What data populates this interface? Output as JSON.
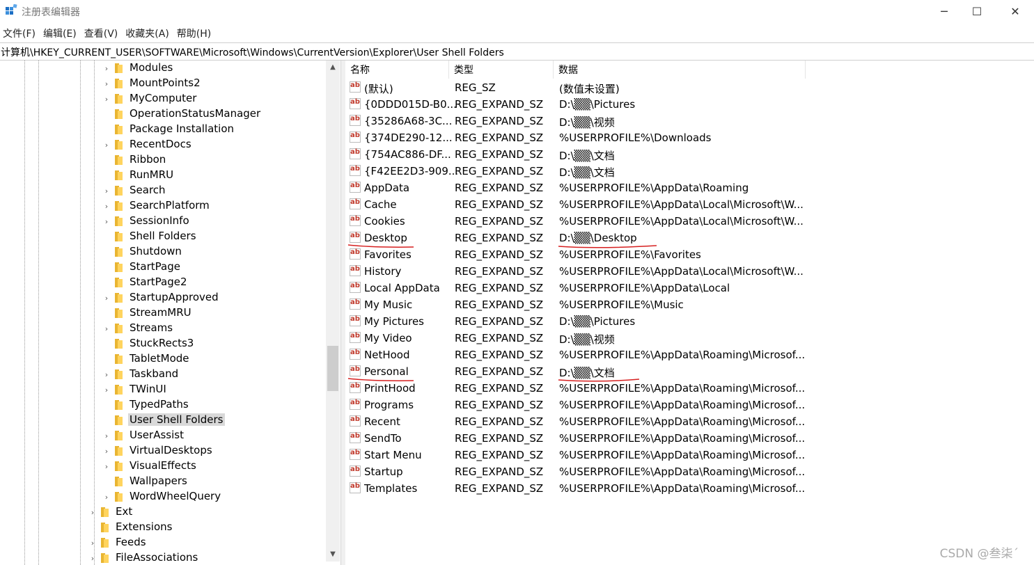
{
  "window": {
    "title": "注册表编辑器",
    "minimize": "─",
    "maximize": "☐",
    "close": "✕"
  },
  "menu": [
    "文件(F)",
    "编辑(E)",
    "查看(V)",
    "收藏夹(A)",
    "帮助(H)"
  ],
  "address": "计算机\\HKEY_CURRENT_USER\\SOFTWARE\\Microsoft\\Windows\\CurrentVersion\\Explorer\\User Shell Folders",
  "tree": {
    "items": [
      {
        "label": "Modules",
        "expander": true,
        "level": 2
      },
      {
        "label": "MountPoints2",
        "expander": true,
        "level": 2
      },
      {
        "label": "MyComputer",
        "expander": true,
        "level": 2
      },
      {
        "label": "OperationStatusManager",
        "expander": false,
        "level": 2
      },
      {
        "label": "Package Installation",
        "expander": false,
        "level": 2
      },
      {
        "label": "RecentDocs",
        "expander": true,
        "level": 2
      },
      {
        "label": "Ribbon",
        "expander": false,
        "level": 2
      },
      {
        "label": "RunMRU",
        "expander": false,
        "level": 2
      },
      {
        "label": "Search",
        "expander": true,
        "level": 2
      },
      {
        "label": "SearchPlatform",
        "expander": true,
        "level": 2
      },
      {
        "label": "SessionInfo",
        "expander": true,
        "level": 2
      },
      {
        "label": "Shell Folders",
        "expander": false,
        "level": 2
      },
      {
        "label": "Shutdown",
        "expander": false,
        "level": 2
      },
      {
        "label": "StartPage",
        "expander": false,
        "level": 2
      },
      {
        "label": "StartPage2",
        "expander": false,
        "level": 2
      },
      {
        "label": "StartupApproved",
        "expander": true,
        "level": 2
      },
      {
        "label": "StreamMRU",
        "expander": false,
        "level": 2
      },
      {
        "label": "Streams",
        "expander": true,
        "level": 2
      },
      {
        "label": "StuckRects3",
        "expander": false,
        "level": 2
      },
      {
        "label": "TabletMode",
        "expander": false,
        "level": 2
      },
      {
        "label": "Taskband",
        "expander": true,
        "level": 2
      },
      {
        "label": "TWinUI",
        "expander": true,
        "level": 2
      },
      {
        "label": "TypedPaths",
        "expander": false,
        "level": 2
      },
      {
        "label": "User Shell Folders",
        "expander": false,
        "level": 2,
        "selected": true
      },
      {
        "label": "UserAssist",
        "expander": true,
        "level": 2
      },
      {
        "label": "VirtualDesktops",
        "expander": true,
        "level": 2
      },
      {
        "label": "VisualEffects",
        "expander": true,
        "level": 2
      },
      {
        "label": "Wallpapers",
        "expander": false,
        "level": 2
      },
      {
        "label": "WordWheelQuery",
        "expander": true,
        "level": 2
      },
      {
        "label": "Ext",
        "expander": true,
        "level": 1
      },
      {
        "label": "Extensions",
        "expander": false,
        "level": 1
      },
      {
        "label": "Feeds",
        "expander": true,
        "level": 1
      },
      {
        "label": "FileAssociations",
        "expander": true,
        "level": 1
      }
    ],
    "expander_glyph": "›",
    "scroll_up": "▲",
    "scroll_down": "▼"
  },
  "list": {
    "columns": [
      "名称",
      "类型",
      "数据"
    ],
    "icon_text": "ab",
    "rows": [
      {
        "name": "(默认)",
        "type": "REG_SZ",
        "data": "(数值未设置)"
      },
      {
        "name": "{0DDD015D-B0...",
        "type": "REG_EXPAND_SZ",
        "data": "D:\\▒▒\\Pictures"
      },
      {
        "name": "{35286A68-3C...",
        "type": "REG_EXPAND_SZ",
        "data": "D:\\▒▒\\视频"
      },
      {
        "name": "{374DE290-12...",
        "type": "REG_EXPAND_SZ",
        "data": "%USERPROFILE%\\Downloads"
      },
      {
        "name": "{754AC886-DF...",
        "type": "REG_EXPAND_SZ",
        "data": "D:\\▒▒\\文档"
      },
      {
        "name": "{F42EE2D3-909...",
        "type": "REG_EXPAND_SZ",
        "data": "D:\\▒▒\\文档"
      },
      {
        "name": "AppData",
        "type": "REG_EXPAND_SZ",
        "data": "%USERPROFILE%\\AppData\\Roaming"
      },
      {
        "name": "Cache",
        "type": "REG_EXPAND_SZ",
        "data": "%USERPROFILE%\\AppData\\Local\\Microsoft\\W..."
      },
      {
        "name": "Cookies",
        "type": "REG_EXPAND_SZ",
        "data": "%USERPROFILE%\\AppData\\Local\\Microsoft\\W..."
      },
      {
        "name": "Desktop",
        "type": "REG_EXPAND_SZ",
        "data": "D:\\▒▒\\Desktop",
        "underlined": true
      },
      {
        "name": "Favorites",
        "type": "REG_EXPAND_SZ",
        "data": "%USERPROFILE%\\Favorites"
      },
      {
        "name": "History",
        "type": "REG_EXPAND_SZ",
        "data": "%USERPROFILE%\\AppData\\Local\\Microsoft\\W..."
      },
      {
        "name": "Local AppData",
        "type": "REG_EXPAND_SZ",
        "data": "%USERPROFILE%\\AppData\\Local"
      },
      {
        "name": "My Music",
        "type": "REG_EXPAND_SZ",
        "data": "%USERPROFILE%\\Music"
      },
      {
        "name": "My Pictures",
        "type": "REG_EXPAND_SZ",
        "data": "D:\\▒▒\\Pictures"
      },
      {
        "name": "My Video",
        "type": "REG_EXPAND_SZ",
        "data": "D:\\▒▒\\视频"
      },
      {
        "name": "NetHood",
        "type": "REG_EXPAND_SZ",
        "data": "%USERPROFILE%\\AppData\\Roaming\\Microsof..."
      },
      {
        "name": "Personal",
        "type": "REG_EXPAND_SZ",
        "data": "D:\\▒▒\\文档",
        "underlined": true
      },
      {
        "name": "PrintHood",
        "type": "REG_EXPAND_SZ",
        "data": "%USERPROFILE%\\AppData\\Roaming\\Microsof..."
      },
      {
        "name": "Programs",
        "type": "REG_EXPAND_SZ",
        "data": "%USERPROFILE%\\AppData\\Roaming\\Microsof..."
      },
      {
        "name": "Recent",
        "type": "REG_EXPAND_SZ",
        "data": "%USERPROFILE%\\AppData\\Roaming\\Microsof..."
      },
      {
        "name": "SendTo",
        "type": "REG_EXPAND_SZ",
        "data": "%USERPROFILE%\\AppData\\Roaming\\Microsof..."
      },
      {
        "name": "Start Menu",
        "type": "REG_EXPAND_SZ",
        "data": "%USERPROFILE%\\AppData\\Roaming\\Microsof..."
      },
      {
        "name": "Startup",
        "type": "REG_EXPAND_SZ",
        "data": "%USERPROFILE%\\AppData\\Roaming\\Microsof..."
      },
      {
        "name": "Templates",
        "type": "REG_EXPAND_SZ",
        "data": "%USERPROFILE%\\AppData\\Roaming\\Microsof..."
      }
    ]
  },
  "watermark": "CSDN @叁柒´",
  "colors": {
    "accent": "#1a73c8",
    "annotation": "#d61f1f",
    "folder": "#ffd45e",
    "selected": "#d9d9d9"
  }
}
